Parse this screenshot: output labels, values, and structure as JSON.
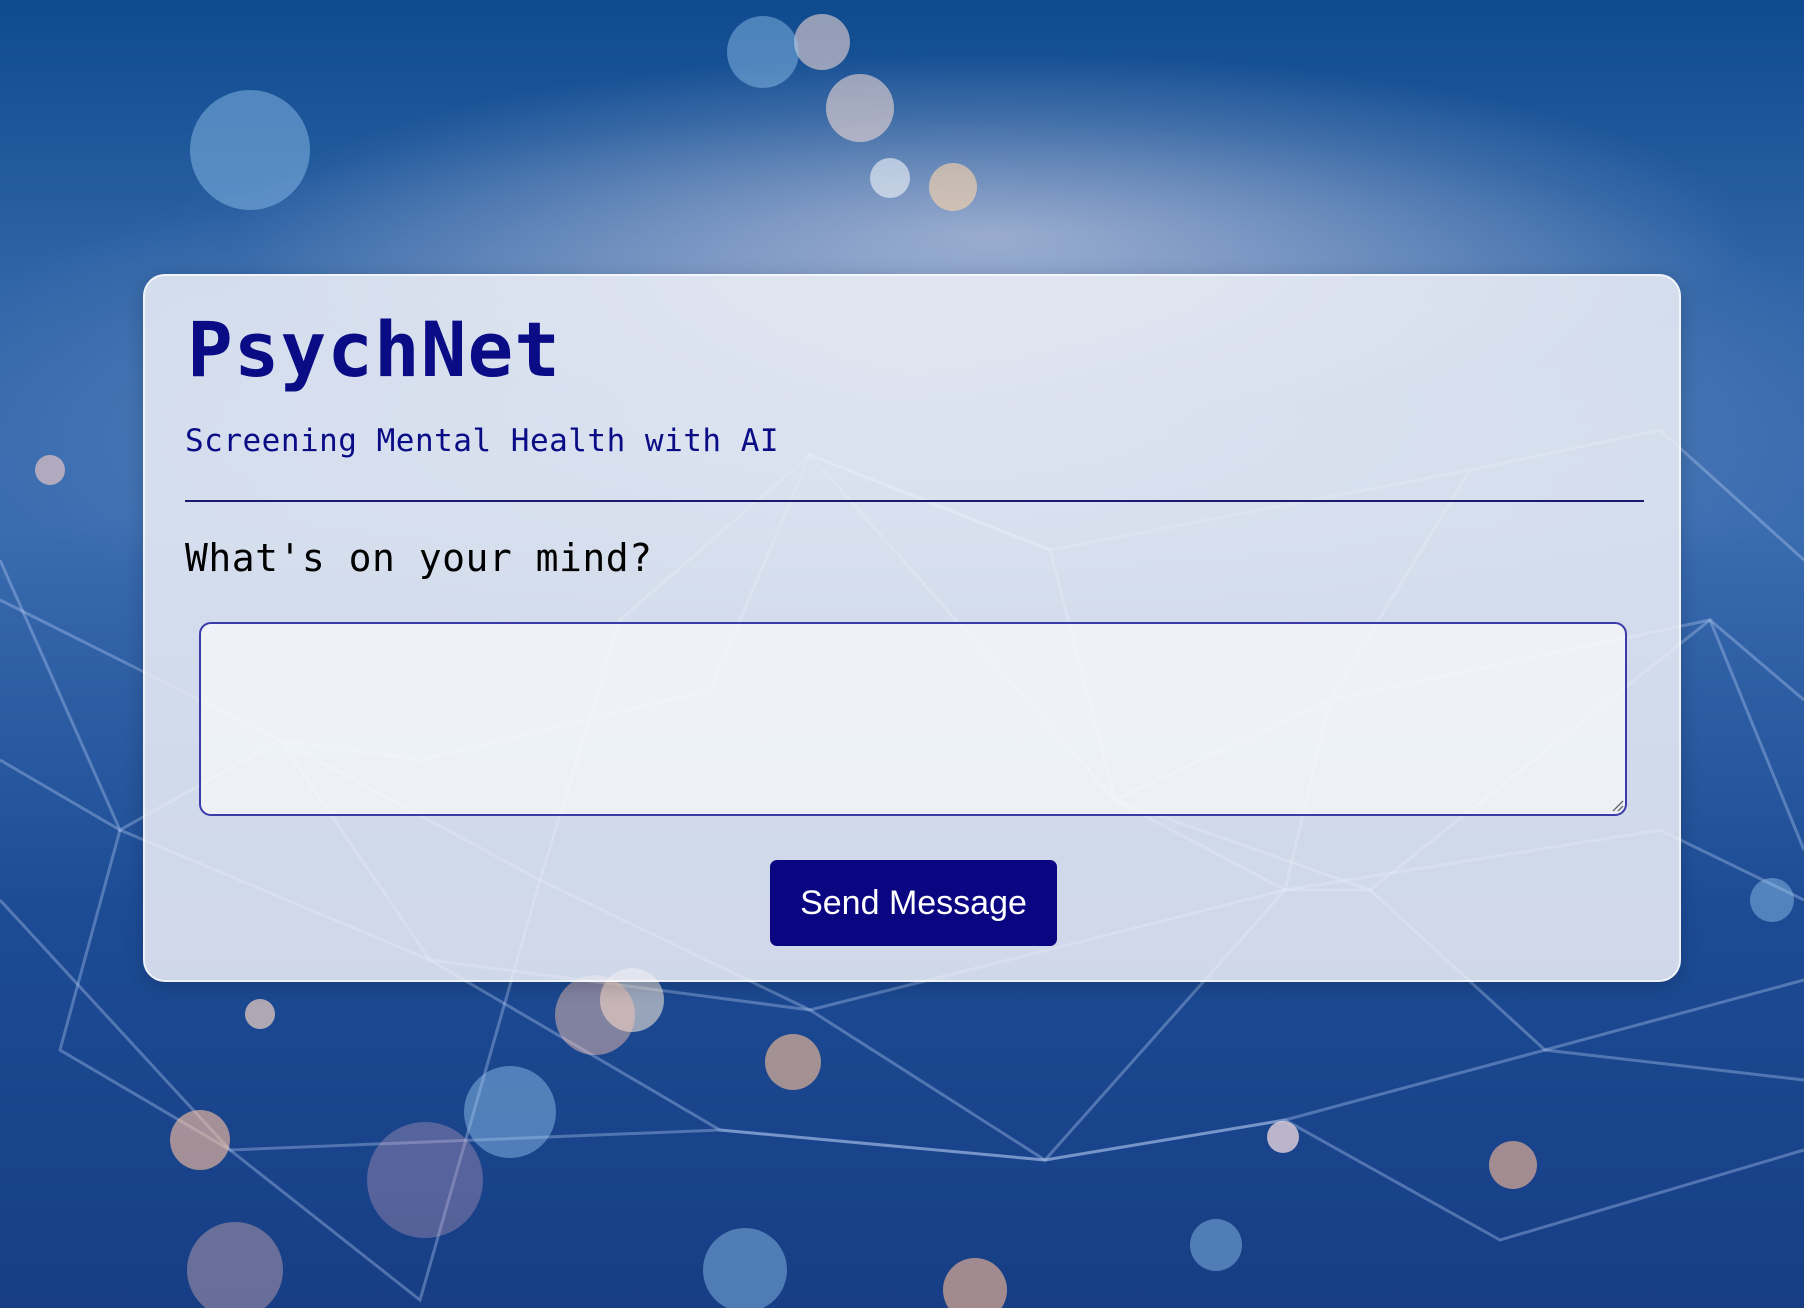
{
  "app": {
    "title": "PsychNet",
    "subtitle": "Screening Mental Health with AI"
  },
  "form": {
    "prompt": "What's on your mind?",
    "message_value": "",
    "message_placeholder": "",
    "send_label": "Send Message"
  },
  "colors": {
    "accent": "#0a0681",
    "title": "#0a0c86",
    "card_background": "#eef0f7",
    "page_background": "#1a3f86"
  }
}
